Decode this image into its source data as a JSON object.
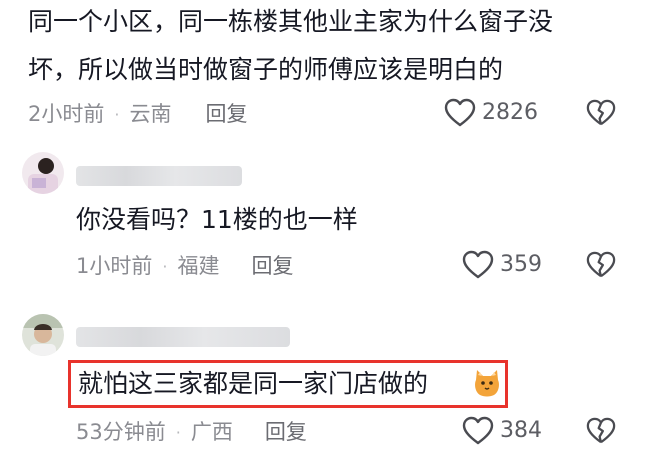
{
  "comments": [
    {
      "text_line1": "同一个小区，同一栋楼其他业主家为什么窗子没",
      "text_line2": "坏，所以做当时做窗子的师傅应该是明白的",
      "time": "2小时前",
      "location": "云南",
      "reply_label": "回复",
      "likes": "2826"
    },
    {
      "text": "你没看吗？11楼的也一样",
      "time": "1小时前",
      "location": "福建",
      "reply_label": "回复",
      "likes": "359"
    },
    {
      "text": "就怕这三家都是同一家门店做的",
      "time": "53分钟前",
      "location": "广西",
      "reply_label": "回复",
      "likes": "384"
    }
  ],
  "separator": "·",
  "highlight_color": "#e8332c",
  "icons": {
    "like": "heart-outline-icon",
    "dislike": "broken-heart-icon",
    "emoji": "cat-emoji-icon"
  }
}
